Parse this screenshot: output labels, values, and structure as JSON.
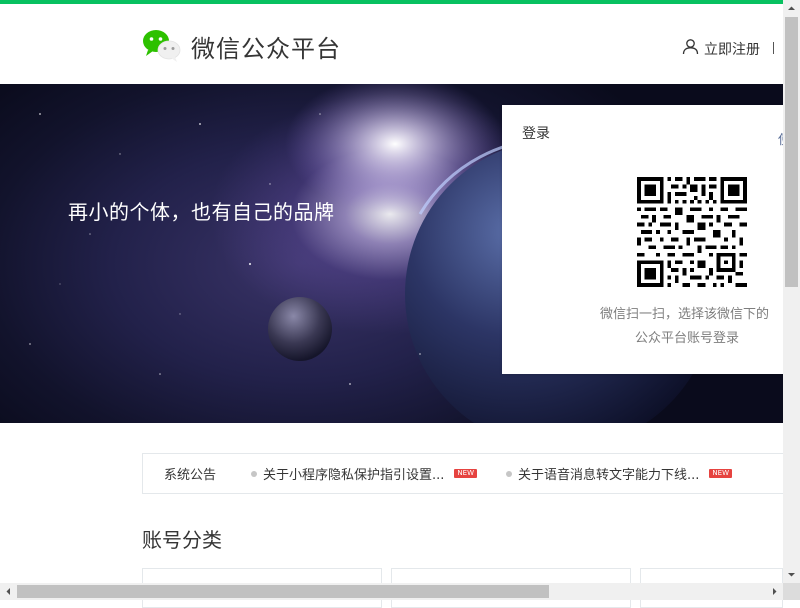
{
  "header": {
    "logo_icon": "wechat-logo-icon",
    "brand_color": "#07c160",
    "title": "微信公众平台",
    "register_label": "立即注册",
    "register_icon": "user-icon"
  },
  "banner": {
    "slogan": "再小的个体，也有自己的品牌"
  },
  "login": {
    "title": "登录",
    "corner_text": "使",
    "qr_icon": "qr-code-icon",
    "tip_line1": "微信扫一扫，选择该微信下的",
    "tip_line2": "公众平台账号登录"
  },
  "notice": {
    "title": "系统公告",
    "items": [
      {
        "text": "关于小程序隐私保护指引设置...",
        "badge": "NEW"
      },
      {
        "text": "关于语音消息转文字能力下线...",
        "badge": "NEW"
      }
    ]
  },
  "section": {
    "title": "账号分类"
  }
}
